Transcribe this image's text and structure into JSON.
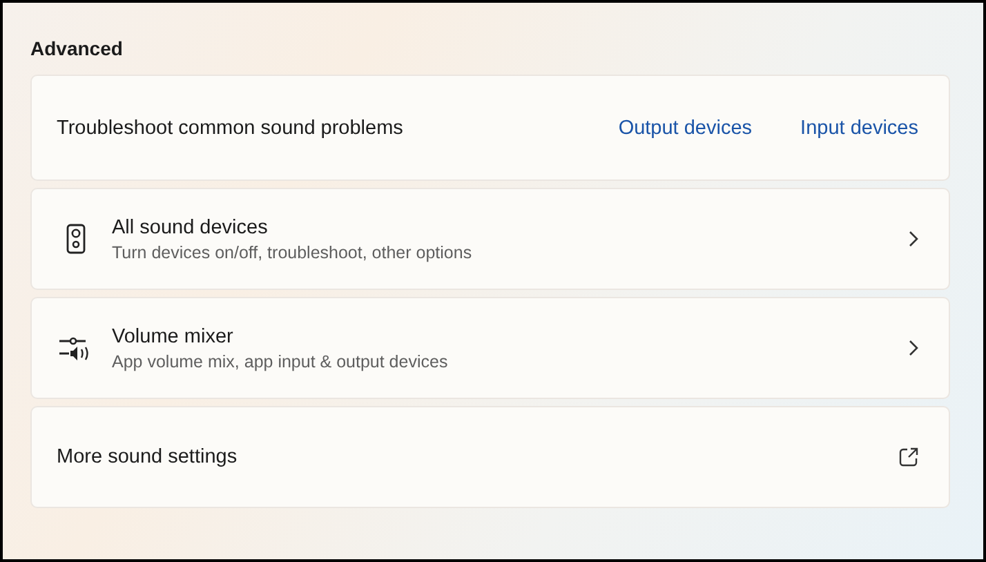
{
  "section_title": "Advanced",
  "rows": [
    {
      "kind": "links",
      "title": "Troubleshoot common sound problems",
      "links": [
        "Output devices",
        "Input devices"
      ]
    },
    {
      "kind": "devices",
      "title": "All sound devices",
      "subtitle": "Turn devices on/off, troubleshoot, other options"
    },
    {
      "kind": "mixer",
      "title": "Volume mixer",
      "subtitle": "App volume mix, app input & output devices"
    },
    {
      "kind": "external",
      "title": "More sound settings"
    }
  ]
}
